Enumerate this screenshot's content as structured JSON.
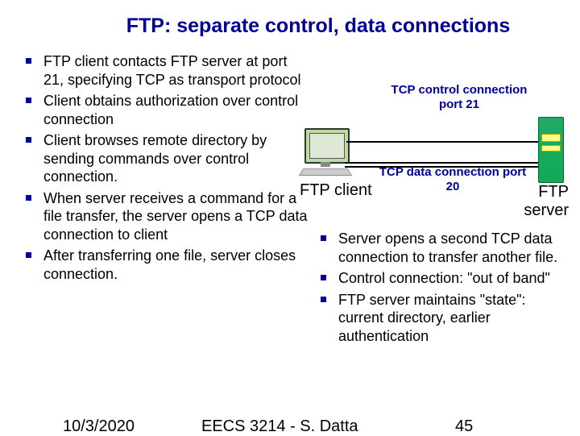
{
  "title": "FTP: separate control, data connections",
  "left_bullets": [
    "FTP client contacts FTP server at port 21, specifying TCP as transport protocol",
    "Client obtains authorization over control connection",
    "Client browses remote directory by sending commands over control connection.",
    "When server receives a command for a file transfer, the server opens a TCP data connection to client",
    "After transferring one file, server closes connection."
  ],
  "right_bullets": [
    "Server opens a second TCP data connection to transfer another file.",
    "Control connection: \"out of band\"",
    "FTP server maintains \"state\": current directory, earlier authentication"
  ],
  "diagram": {
    "control_label": "TCP control connection port 21",
    "data_label": "TCP data connection port 20",
    "client_label": "FTP client",
    "server_label": "FTP server"
  },
  "footer": {
    "date": "10/3/2020",
    "course": "EECS 3214 - S. Datta",
    "page": "45"
  }
}
